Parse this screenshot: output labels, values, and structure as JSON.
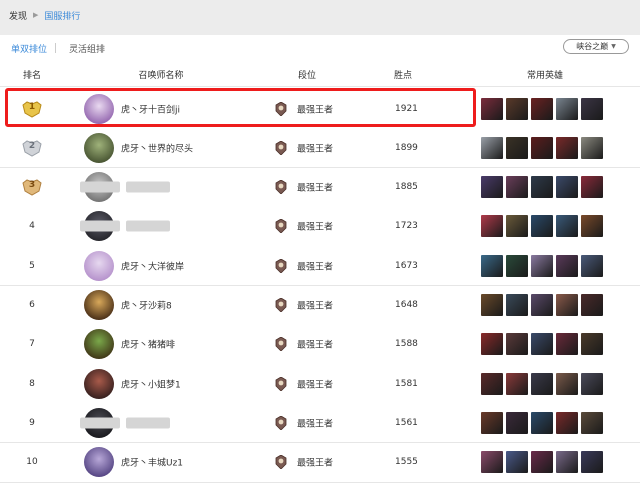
{
  "breadcrumb": {
    "home": "发现",
    "current": "国服排行"
  },
  "tabs": [
    {
      "label": "单双排位",
      "active": true
    },
    {
      "label": "灵活组排",
      "active": false
    }
  ],
  "mode_select": {
    "value": "峡谷之巅"
  },
  "headers": {
    "rank": "排名",
    "name": "召唤师名称",
    "tier": "段位",
    "points": "胜点",
    "heroes": "常用英雄"
  },
  "rows": [
    {
      "rank": "1",
      "medal": "gold",
      "name": "虎丶牙十百剑ji",
      "name_blurred": false,
      "tier": "最强王者",
      "points": "1921",
      "avatar": [
        "#e9d9f0",
        "#8a5aa8"
      ],
      "heroes": [
        "#7b2c3c",
        "#5a3a2a",
        "#6b2222",
        "#7a8590",
        "#3b3545"
      ]
    },
    {
      "rank": "2",
      "medal": "silver",
      "name": "虎牙丶世界的尽头",
      "name_blurred": false,
      "tier": "最强王者",
      "points": "1899",
      "avatar": [
        "#9fb27a",
        "#3e4a2a"
      ],
      "heroes": [
        "#9aa0a8",
        "#3a3226",
        "#5c1d1d",
        "#7a2a2a",
        "#8b8a80"
      ]
    },
    {
      "rank": "3",
      "medal": "bronze",
      "name": "",
      "name_blurred": true,
      "tier": "最强王者",
      "points": "1885",
      "avatar": [
        "#c8c8c8",
        "#6a6a6a"
      ],
      "heroes": [
        "#4a3b6a",
        "#6a3e5a",
        "#2e3a4a",
        "#3b4a6a",
        "#8a2a3a"
      ]
    },
    {
      "rank": "4",
      "medal": "none",
      "name": "",
      "name_blurred": true,
      "tier": "最强王者",
      "points": "1723",
      "avatar": [
        "#5a5a66",
        "#1f1f24"
      ],
      "heroes": [
        "#b03a4a",
        "#6a5a3a",
        "#2a4a6a",
        "#3a5a7a",
        "#7a4a2a"
      ]
    },
    {
      "rank": "5",
      "medal": "none",
      "name": "虎牙丶大洋彼岸",
      "name_blurred": false,
      "tier": "最强王者",
      "points": "1673",
      "avatar": [
        "#e6d8ef",
        "#b08ac8"
      ],
      "heroes": [
        "#3a6a8a",
        "#2a4a3a",
        "#8a7aa0",
        "#5a3a5a",
        "#4a5a7a"
      ]
    },
    {
      "rank": "6",
      "medal": "none",
      "name": "虎丶牙沙莉8",
      "name_blurred": false,
      "tier": "最强王者",
      "points": "1648",
      "avatar": [
        "#d8a85a",
        "#3a2210"
      ],
      "heroes": [
        "#6a4a2a",
        "#3a4a5a",
        "#5a4a6a",
        "#8a5a4a",
        "#4a2a2a"
      ]
    },
    {
      "rank": "7",
      "medal": "none",
      "name": "虎牙丶猪猪啡",
      "name_blurred": false,
      "tier": "最强王者",
      "points": "1588",
      "avatar": [
        "#7aa84a",
        "#3a2a12"
      ],
      "heroes": [
        "#8a2a2a",
        "#5a3a3a",
        "#3a4a6a",
        "#6a2a3a",
        "#4a3a2a"
      ]
    },
    {
      "rank": "8",
      "medal": "none",
      "name": "虎牙丶小姐梦1",
      "name_blurred": false,
      "tier": "最强王者",
      "points": "1581",
      "avatar": [
        "#a85a4a",
        "#2a1a1a"
      ],
      "heroes": [
        "#5a2a2a",
        "#8a3a3a",
        "#3a3a4a",
        "#7a5a4a",
        "#4a4a5a"
      ]
    },
    {
      "rank": "9",
      "medal": "none",
      "name": "",
      "name_blurred": true,
      "tier": "最强王者",
      "points": "1561",
      "avatar": [
        "#4a4a52",
        "#141418"
      ],
      "heroes": [
        "#6a3a2a",
        "#3a2a3a",
        "#2a4a6a",
        "#7a2a2a",
        "#5a4a3a"
      ]
    },
    {
      "rank": "10",
      "medal": "none",
      "name": "虎牙丶丰城Uz1",
      "name_blurred": false,
      "tier": "最强王者",
      "points": "1555",
      "avatar": [
        "#b8a8d8",
        "#4a3a7a"
      ],
      "heroes": [
        "#8a4a6a",
        "#4a5a8a",
        "#6a2a4a",
        "#7a6a8a",
        "#3a3a5a"
      ]
    }
  ]
}
